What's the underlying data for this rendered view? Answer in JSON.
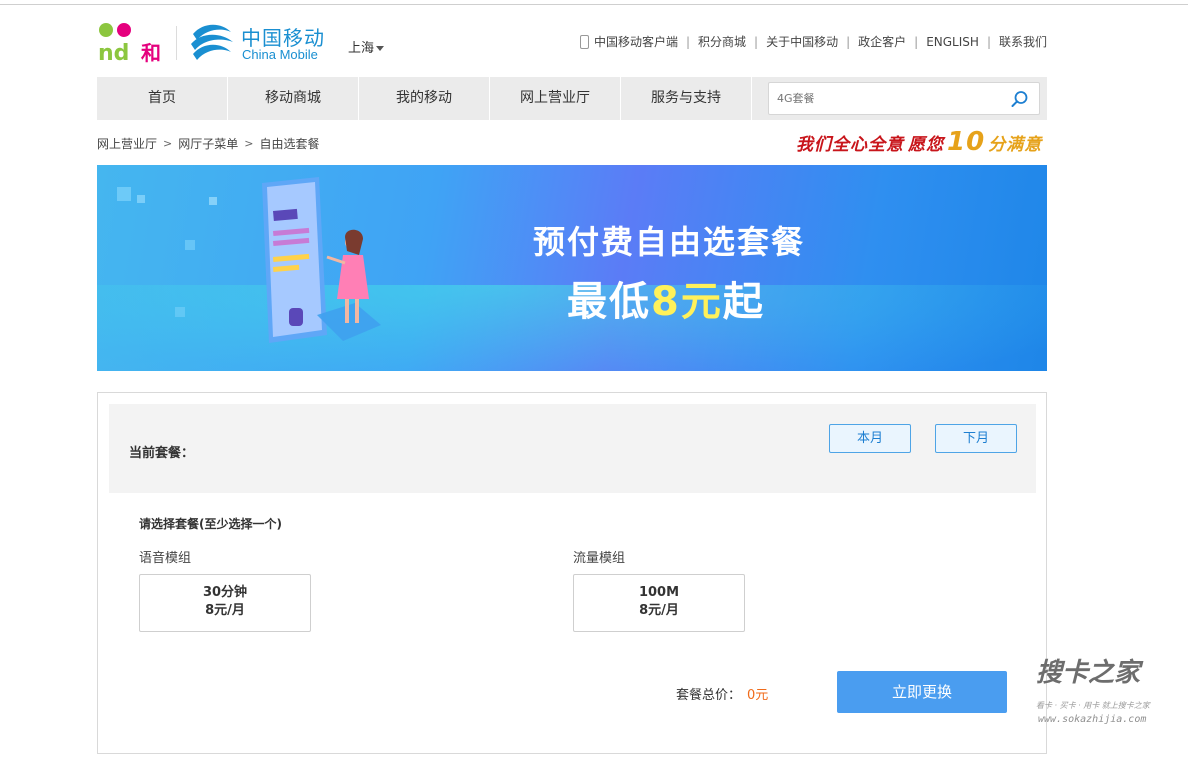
{
  "header": {
    "and_logo": "and和",
    "brand_cn": "中国移动",
    "brand_en": "China Mobile",
    "city": "上海"
  },
  "toplinks": [
    "中国移动客户端",
    "积分商城",
    "关于中国移动",
    "政企客户",
    "ENGLISH",
    "联系我们"
  ],
  "nav": {
    "items": [
      "首页",
      "移动商城",
      "我的移动",
      "网上营业厅",
      "服务与支持"
    ],
    "search_placeholder": "4G套餐"
  },
  "breadcrumb": [
    "网上营业厅",
    "网厅子菜单",
    "自由选套餐"
  ],
  "slogan": {
    "part1": "我们全心全意",
    "part2": "愿您",
    "ten": "10",
    "part3": "分满意"
  },
  "banner": {
    "title": "预付费自由选套餐",
    "sub_before": "最低",
    "sub_highlight": "8元",
    "sub_after": "起"
  },
  "panel": {
    "current_label": "当前套餐：",
    "this_month": "本月",
    "next_month": "下月",
    "choose_title": "请选择套餐(至少选择一个)",
    "voice_group": "语音模组",
    "data_group": "流量模组",
    "voice_option": {
      "name": "30分钟",
      "price": "8元/月"
    },
    "data_option": {
      "name": "100M",
      "price": "8元/月"
    },
    "total_label": "套餐总价：",
    "total_value": "0元",
    "submit": "立即更换"
  },
  "watermark": {
    "logo": "搜卡之家",
    "line1": "看卡 · 买卡 · 用卡 就上搜卡之家",
    "line2": "www.sokazhijia.com"
  },
  "colors": {
    "brand_blue": "#1a8fd1",
    "nav_bg": "#ebebeb",
    "button_blue": "#4a9df0",
    "price_orange": "#f06b1a"
  }
}
